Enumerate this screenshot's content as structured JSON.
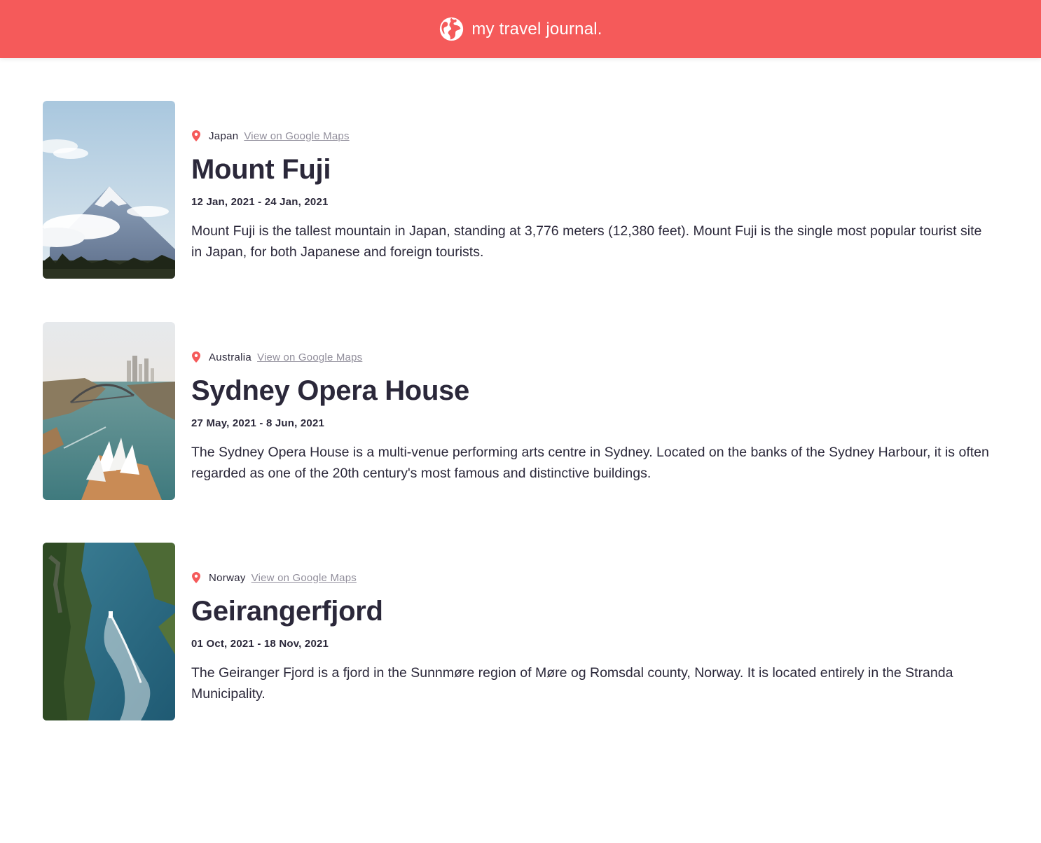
{
  "header": {
    "title": "my travel journal.",
    "icon": "globe-icon",
    "background": "#F55A5A"
  },
  "entries": [
    {
      "country": "Japan",
      "maps_link": "View on Google Maps",
      "title": "Mount Fuji",
      "dates": "12 Jan, 2021 - 24 Jan, 2021",
      "description": "Mount Fuji is the tallest mountain in Japan, standing at 3,776 meters (12,380 feet). Mount Fuji is the single most popular tourist site in Japan, for both Japanese and foreign tourists.",
      "image": "mount-fuji-photo"
    },
    {
      "country": "Australia",
      "maps_link": "View on Google Maps",
      "title": "Sydney Opera House",
      "dates": "27 May, 2021 - 8 Jun, 2021",
      "description": "The Sydney Opera House is a multi-venue performing arts centre in Sydney. Located on the banks of the Sydney Harbour, it is often regarded as one of the 20th century's most famous and distinctive buildings.",
      "image": "sydney-opera-house-photo"
    },
    {
      "country": "Norway",
      "maps_link": "View on Google Maps",
      "title": "Geirangerfjord",
      "dates": "01 Oct, 2021 - 18 Nov, 2021",
      "description": "The Geiranger Fjord is a fjord in the Sunnmøre region of Møre og Romsdal county, Norway. It is located entirely in the Stranda Municipality.",
      "image": "geirangerfjord-photo"
    }
  ],
  "colors": {
    "accent": "#F55A5A",
    "text": "#2B283A",
    "link": "#918E9B"
  }
}
